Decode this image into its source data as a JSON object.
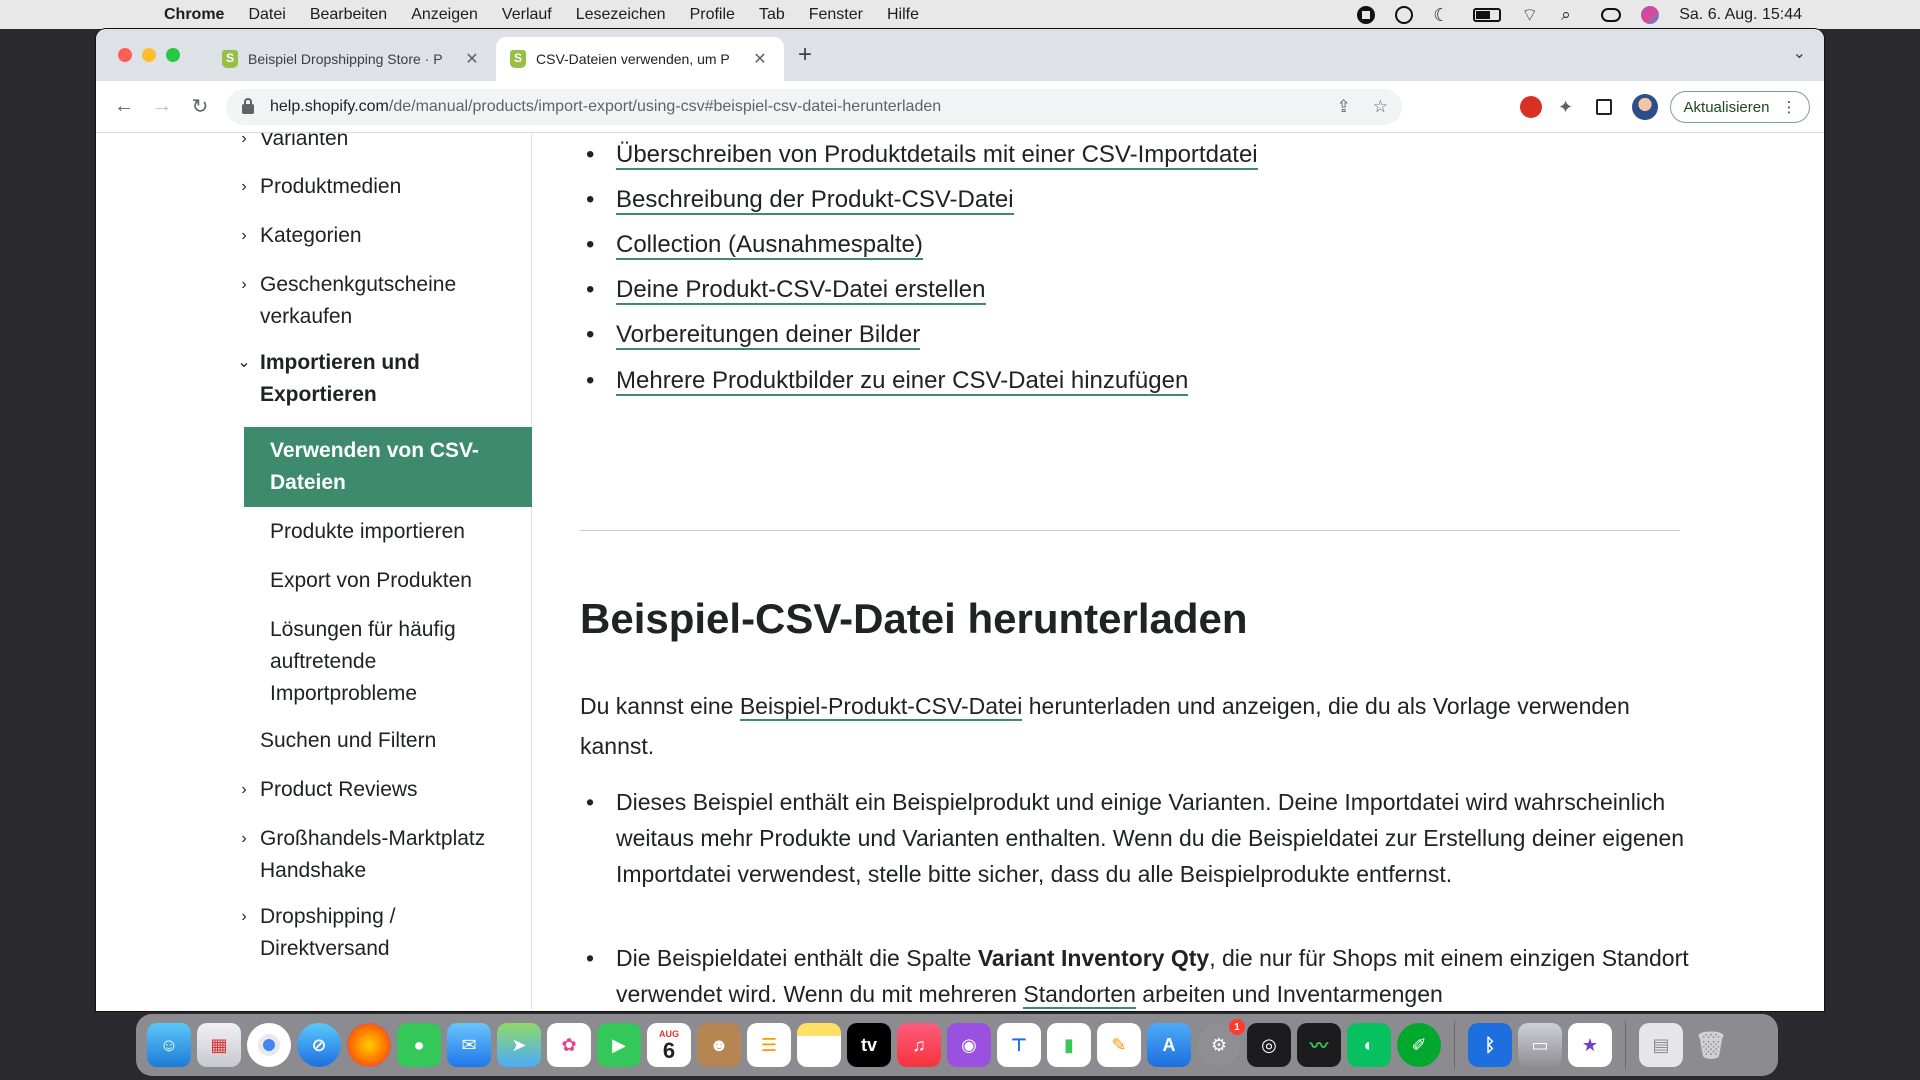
{
  "menubar": {
    "app_name": "Chrome",
    "items": [
      "Datei",
      "Bearbeiten",
      "Anzeigen",
      "Verlauf",
      "Lesezeichen",
      "Profile",
      "Tab",
      "Fenster",
      "Hilfe"
    ],
    "clock": "Sa. 6. Aug.  15:44"
  },
  "browser": {
    "tabs": [
      {
        "title": "Beispiel Dropshipping Store · P",
        "active": false
      },
      {
        "title": "CSV-Dateien verwenden, um P",
        "active": true
      }
    ],
    "url_host": "help.shopify.com",
    "url_path": "/de/manual/products/import-export/using-csv#beispiel-csv-datei-herunterladen",
    "update_label": "Aktualisieren"
  },
  "sidebar": {
    "item_varianten": "Varianten",
    "item_produktmedien": "Produktmedien",
    "item_kategorien": "Kategorien",
    "item_geschenk": "Geschenkgutscheine verkaufen",
    "item_import_export": "Importieren und Exportieren",
    "sub_active": "Verwenden von CSV-Dateien",
    "sub_produkte_importieren": "Produkte importieren",
    "sub_export": "Export von Produkten",
    "sub_loesungen": "Lösungen für häufig auftretende Importprobleme",
    "item_suchen": "Suchen und Filtern",
    "item_reviews": "Product Reviews",
    "item_handshake": "Großhandels-Marktplatz Handshake",
    "item_dropshipping": "Dropshipping / Direktversand"
  },
  "content": {
    "toc": [
      "Überschreiben von Produktdetails mit einer CSV-Importdatei",
      "Beschreibung der Produkt-CSV-Datei",
      "Collection (Ausnahmespalte)",
      "Deine Produkt-CSV-Datei erstellen",
      "Vorbereitungen deiner Bilder",
      "Mehrere Produktbilder zu einer CSV-Datei hinzufügen"
    ],
    "heading": "Beispiel-CSV-Datei herunterladen",
    "intro_before": "Du kannst eine ",
    "intro_link": "Beispiel-Produkt-CSV-Datei",
    "intro_after": " herunterladen und anzeigen, die du als Vorlage verwenden kannst.",
    "bullet1": "Dieses Beispiel enthält ein Beispielprodukt und einige Varianten. Deine Importdatei wird wahrscheinlich weitaus mehr Produkte und Varianten enthalten. Wenn du die Beispieldatei zur Erstellung deiner eigenen Importdatei verwendest, stelle bitte sicher, dass du alle Beispielprodukte entfernst.",
    "bullet2_before": "Die Beispieldatei enthält die Spalte ",
    "bullet2_bold": "Variant Inventory Qty",
    "bullet2_mid": ", die nur für Shops mit einem einzigen Standort verwendet wird. Wenn du mit mehreren ",
    "bullet2_link": "Standorten",
    "bullet2_after": " arbeiten und Inventarmengen"
  },
  "dock": {
    "calendar_month": "AUG",
    "calendar_day": "6",
    "settings_badge": "1"
  },
  "colors": {
    "accent": "#3d8a6c",
    "tab_strip": "#dee1e6"
  }
}
